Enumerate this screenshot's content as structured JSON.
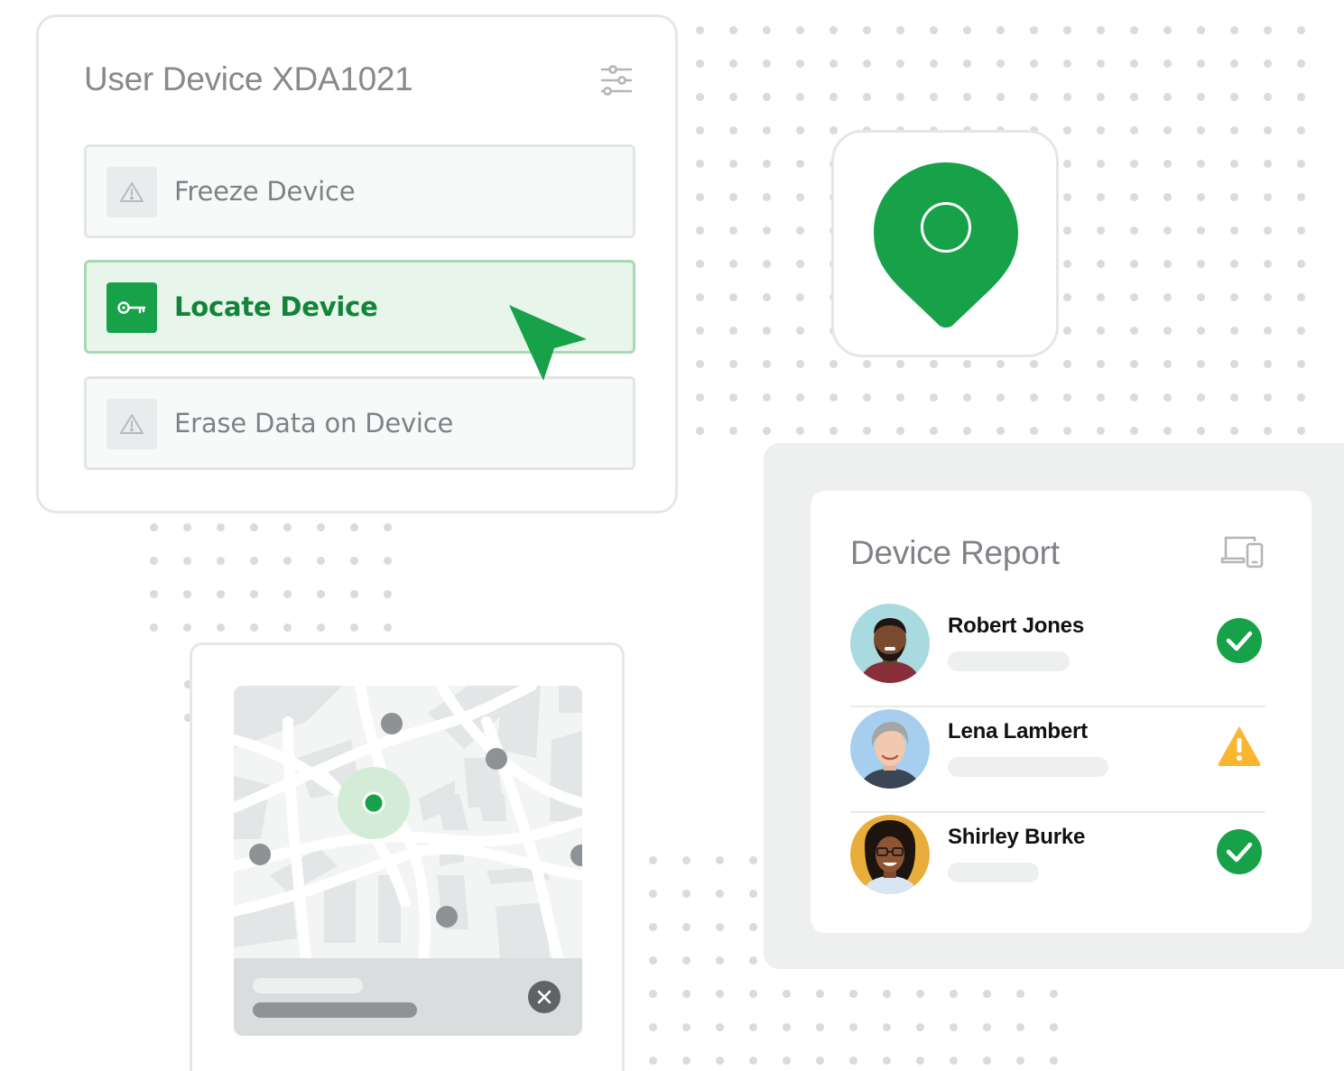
{
  "device_card": {
    "title": "User Device XDA1021",
    "actions": [
      {
        "label": "Freeze Device",
        "state": "default",
        "icon": "warning-icon"
      },
      {
        "label": "Locate Device",
        "state": "active",
        "icon": "key-icon"
      },
      {
        "label": "Erase Data on Device",
        "state": "default",
        "icon": "warning-icon"
      }
    ]
  },
  "report": {
    "title": "Device Report",
    "rows": [
      {
        "name": "Robert Jones",
        "status": "ok",
        "status_icon": "check-circle-icon"
      },
      {
        "name": "Lena Lambert",
        "status": "warning",
        "status_icon": "warning-triangle-icon"
      },
      {
        "name": "Shirley Burke",
        "status": "ok",
        "status_icon": "check-circle-icon"
      }
    ]
  },
  "colors": {
    "accent": "#17a249",
    "accent_light": "#e8f5ea",
    "warning": "#fbb62f",
    "text_muted": "#868a8d"
  }
}
